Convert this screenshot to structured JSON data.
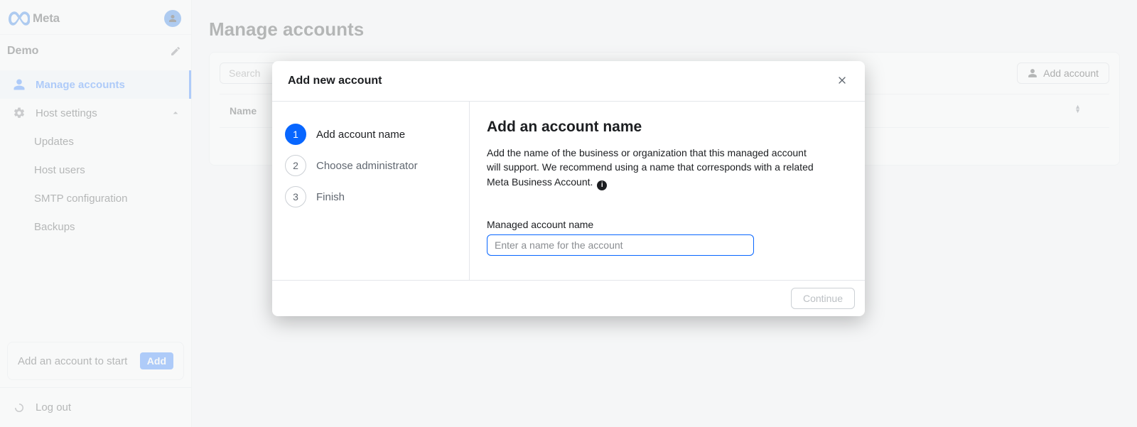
{
  "brand": "Meta",
  "org_name": "Demo",
  "sidebar": {
    "manage_accounts": "Manage accounts",
    "host_settings": "Host settings",
    "updates": "Updates",
    "host_users": "Host users",
    "smtp": "SMTP configuration",
    "backups": "Backups",
    "add_card_text": "Add an account to start",
    "add_card_btn": "Add",
    "logout": "Log out"
  },
  "page": {
    "title": "Manage accounts",
    "search_placeholder": "Search",
    "add_account_btn": "Add account",
    "col_name": "Name"
  },
  "modal": {
    "title": "Add new account",
    "steps": {
      "s1": "Add account name",
      "s2": "Choose administrator",
      "s3": "Finish"
    },
    "content_title": "Add an account name",
    "content_desc": "Add the name of the business or organization that this managed account will support. We recommend using a name that corresponds with a related Meta Business Account.",
    "info_char": "i",
    "field_label": "Managed account name",
    "input_placeholder": "Enter a name for the account",
    "continue": "Continue"
  }
}
